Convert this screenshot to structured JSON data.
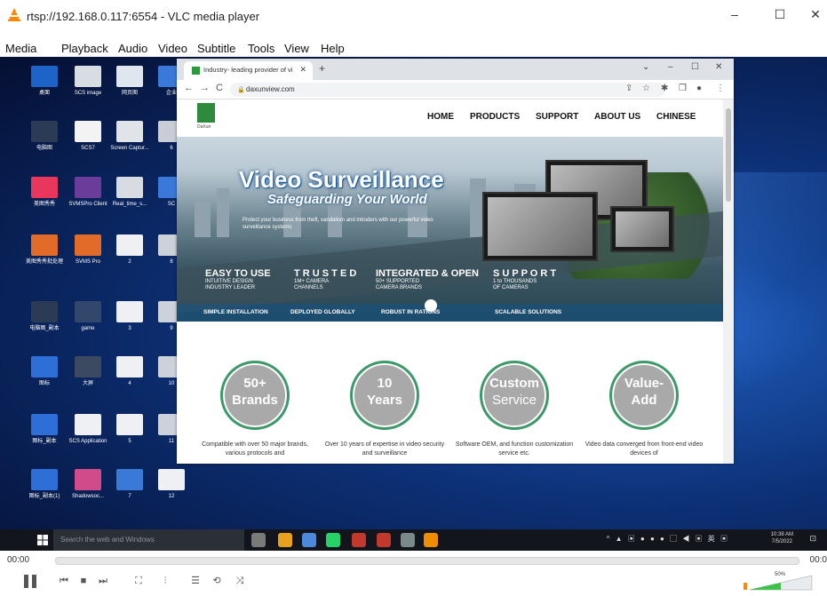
{
  "vlc": {
    "title": "rtsp://192.168.0.117:6554 - VLC media player",
    "window_controls": [
      "–",
      "☐",
      "✕"
    ],
    "menu": [
      "Media",
      "Playback",
      "Audio",
      "Video",
      "Subtitle",
      "Tools",
      "View",
      "Help"
    ],
    "time_current": "00:00",
    "time_total": "00:0",
    "volume": "50%",
    "colors": {
      "accent": "#ff8800"
    }
  },
  "desktop": {
    "icons": [
      {
        "label": "桌面",
        "color": "#1e64c8"
      },
      {
        "label": "SCS image",
        "color": "#d8dde4"
      },
      {
        "label": "网页图",
        "color": "#dfe6f0"
      },
      {
        "label": "企业",
        "color": "#3a79d8"
      },
      {
        "label": "电脑图",
        "color": "#2b3a55"
      },
      {
        "label": "SCS7",
        "color": "#f3f3f3"
      },
      {
        "label": "Screen Captur...",
        "color": "#e0e3e8"
      },
      {
        "label": "6",
        "color": "#c9ced6"
      },
      {
        "label": "美图秀秀",
        "color": "#e8365d"
      },
      {
        "label": "SVMSPro Client",
        "color": "#6a3d9a"
      },
      {
        "label": "Real_time_s...",
        "color": "#d8dce2"
      },
      {
        "label": "SC",
        "color": "#3a79d8"
      },
      {
        "label": "美图秀秀批处理",
        "color": "#e26b2a"
      },
      {
        "label": "SVMS Pro",
        "color": "#e26b2a"
      },
      {
        "label": "2",
        "color": "#eef0f3"
      },
      {
        "label": "8",
        "color": "#ccd2da"
      },
      {
        "label": "电脑图_副本",
        "color": "#2b3a55"
      },
      {
        "label": "game",
        "color": "#31476b"
      },
      {
        "label": "3",
        "color": "#eef0f3"
      },
      {
        "label": "9",
        "color": "#ccd2da"
      },
      {
        "label": "图标",
        "color": "#2d6fd6"
      },
      {
        "label": "大屏",
        "color": "#3b4a61"
      },
      {
        "label": "4",
        "color": "#eef0f3"
      },
      {
        "label": "10",
        "color": "#ccd2da"
      },
      {
        "label": "图标_副本",
        "color": "#2d6fd6"
      },
      {
        "label": "SCS Application",
        "color": "#eef0f3"
      },
      {
        "label": "5",
        "color": "#eef0f3"
      },
      {
        "label": "11",
        "color": "#ccd2da"
      },
      {
        "label": "图标_副本(1)",
        "color": "#2d6fd6"
      },
      {
        "label": "Shadowsoc...",
        "color": "#d14a8a"
      },
      {
        "label": "7",
        "color": "#3a79d8"
      },
      {
        "label": "12",
        "color": "#eef0f3"
      }
    ],
    "taskbar": {
      "search_placeholder": "Search the web and Windows",
      "time": "10:38 AM",
      "date": "7/5/2022",
      "apps": [
        "#7a7a7a",
        "#e8a21b",
        "#4a89dc",
        "#25d366",
        "#c0392b",
        "#c0392b",
        "#7a8a8a",
        "#f08c00"
      ]
    }
  },
  "browser": {
    "tab_title": "Industry- leading provider of vid",
    "tab_close": "✕",
    "new_tab": "+",
    "window_controls": [
      "⌄",
      "–",
      "☐",
      "✕"
    ],
    "nav": [
      "←",
      "→",
      "C"
    ],
    "url": "daxunview.com",
    "toolbar_icons": [
      "⇪",
      "☆",
      "✱",
      "❒",
      "●",
      "⋮"
    ]
  },
  "site": {
    "logo_text": "DaXun",
    "nav": [
      "HOME",
      "PRODUCTS",
      "SUPPORT",
      "ABOUT US",
      "CHINESE"
    ],
    "hero": {
      "title": "Video Surveillance",
      "subtitle": "Safeguarding Your World",
      "tagline": "Protect your business from theft, vandalism and intruders with our powerful video surveillance systems"
    },
    "features": [
      {
        "head": "EASY TO USE",
        "sub1": "INTUITIVE DESIGN",
        "sub2": "INDUSTRY LEADER"
      },
      {
        "head": "T R U S T E D",
        "sub1": "1M+ CAMERA",
        "sub2": "CHANNELS"
      },
      {
        "head": "INTEGRATED & OPEN",
        "sub1": "50+ SUPPORTED",
        "sub2": "CAMERA BRANDS"
      },
      {
        "head": "S U P P O R T",
        "sub1": "1 to THOUSANDS",
        "sub2": "OF CAMERAS"
      }
    ],
    "strip": [
      "SIMPLE INSTALLATION",
      "DEPLOYED GLOBALLY",
      "ROBUST IN  RATIONS",
      "SCALABLE SOLUTIONS"
    ],
    "cards": [
      {
        "line1": "50+",
        "line2": "Brands",
        "desc": "Compatible with over 50 major brands, various protocols and"
      },
      {
        "line1": "10",
        "line2": "Years",
        "desc": "Over 10 years of expertise in video security and surveillance"
      },
      {
        "line1": "Custom",
        "line2": "Service",
        "desc": "Software OEM, and function customization service etc."
      },
      {
        "line1": "Value-",
        "line2": "Add",
        "desc": "Video data converged from front-end video devices of"
      }
    ]
  }
}
